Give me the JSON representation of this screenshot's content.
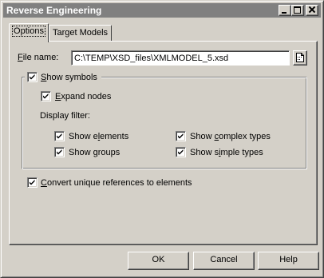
{
  "window": {
    "title": "Reverse Engineering"
  },
  "tabs": [
    {
      "label": "Options",
      "selected": true
    },
    {
      "label": "Target Models",
      "selected": false
    }
  ],
  "file": {
    "label_prefix": "F",
    "label_rest": "ile name:",
    "value": "C:\\TEMP\\XSD_files\\XMLMODEL_5.xsd",
    "browse_icon": "file-browse-icon"
  },
  "options": {
    "show_symbols": {
      "u": "S",
      "rest": "how symbols",
      "checked": true
    },
    "expand_nodes": {
      "u": "E",
      "rest": "xpand nodes",
      "checked": true
    },
    "display_filter_label": "Display filter:",
    "show_elements": {
      "pre": "Show e",
      "u": "l",
      "post": "ements",
      "checked": true
    },
    "show_groups": {
      "pre": "Show ",
      "u": "g",
      "post": "roups",
      "checked": true
    },
    "show_complex_types": {
      "pre": "Show ",
      "u": "c",
      "post": "omplex types",
      "checked": true
    },
    "show_simple_types": {
      "pre": "Show s",
      "u": "i",
      "post": "mple types",
      "checked": true
    },
    "convert_refs": {
      "u": "C",
      "rest": "onvert unique references to elements",
      "checked": true
    }
  },
  "buttons": {
    "ok": "OK",
    "cancel": "Cancel",
    "help": "Help"
  },
  "colors": {
    "face": "#d4d0c8",
    "titlebar_inactive": "#808080",
    "title_text": "#ffffff"
  }
}
